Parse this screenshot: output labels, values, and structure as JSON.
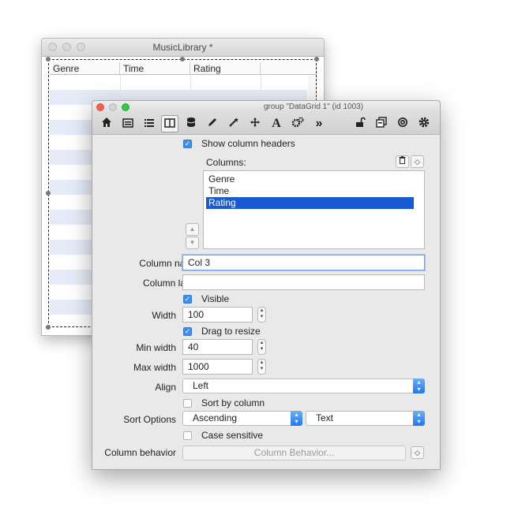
{
  "back_window": {
    "title": "MusicLibrary *",
    "columns": [
      "Genre",
      "Time",
      "Rating"
    ]
  },
  "inspector": {
    "title": "group \"DataGrid 1\" (id 1003)",
    "toolbar_icons": [
      "home-icon",
      "card-icon",
      "list-icon",
      "columns-icon",
      "database-icon",
      "pencil-icon",
      "magic-wand-icon",
      "move-icon",
      "text-icon",
      "gears-icon",
      "more-icon",
      "lock-icon",
      "stack-icon",
      "target-icon",
      "gear-icon"
    ],
    "show_headers_label": "Show column headers",
    "columns_label": "Columns:",
    "columns": [
      "Genre",
      "Time",
      "Rating"
    ],
    "selected_column": "Rating",
    "column_name_label": "Column name",
    "column_name_value": "Col 3",
    "column_label_label": "Column label",
    "column_label_value": "",
    "visible_label": "Visible",
    "width_label": "Width",
    "width_value": "100",
    "drag_resize_label": "Drag to resize",
    "min_width_label": "Min width",
    "min_width_value": "40",
    "max_width_label": "Max width",
    "max_width_value": "1000",
    "align_label": "Align",
    "align_value": "Left",
    "sort_by_column_label": "Sort by column",
    "sort_options_label": "Sort Options",
    "sort_order_value": "Ascending",
    "sort_type_value": "Text",
    "case_sensitive_label": "Case sensitive",
    "column_behavior_label": "Column behavior",
    "column_behavior_button": "Column Behavior..."
  },
  "colors": {
    "accent": "#3d8ef0",
    "selection": "#1a5ad0",
    "close": "#fc5f57",
    "minimize": "#fdbc2e",
    "zoom": "#33c748"
  }
}
